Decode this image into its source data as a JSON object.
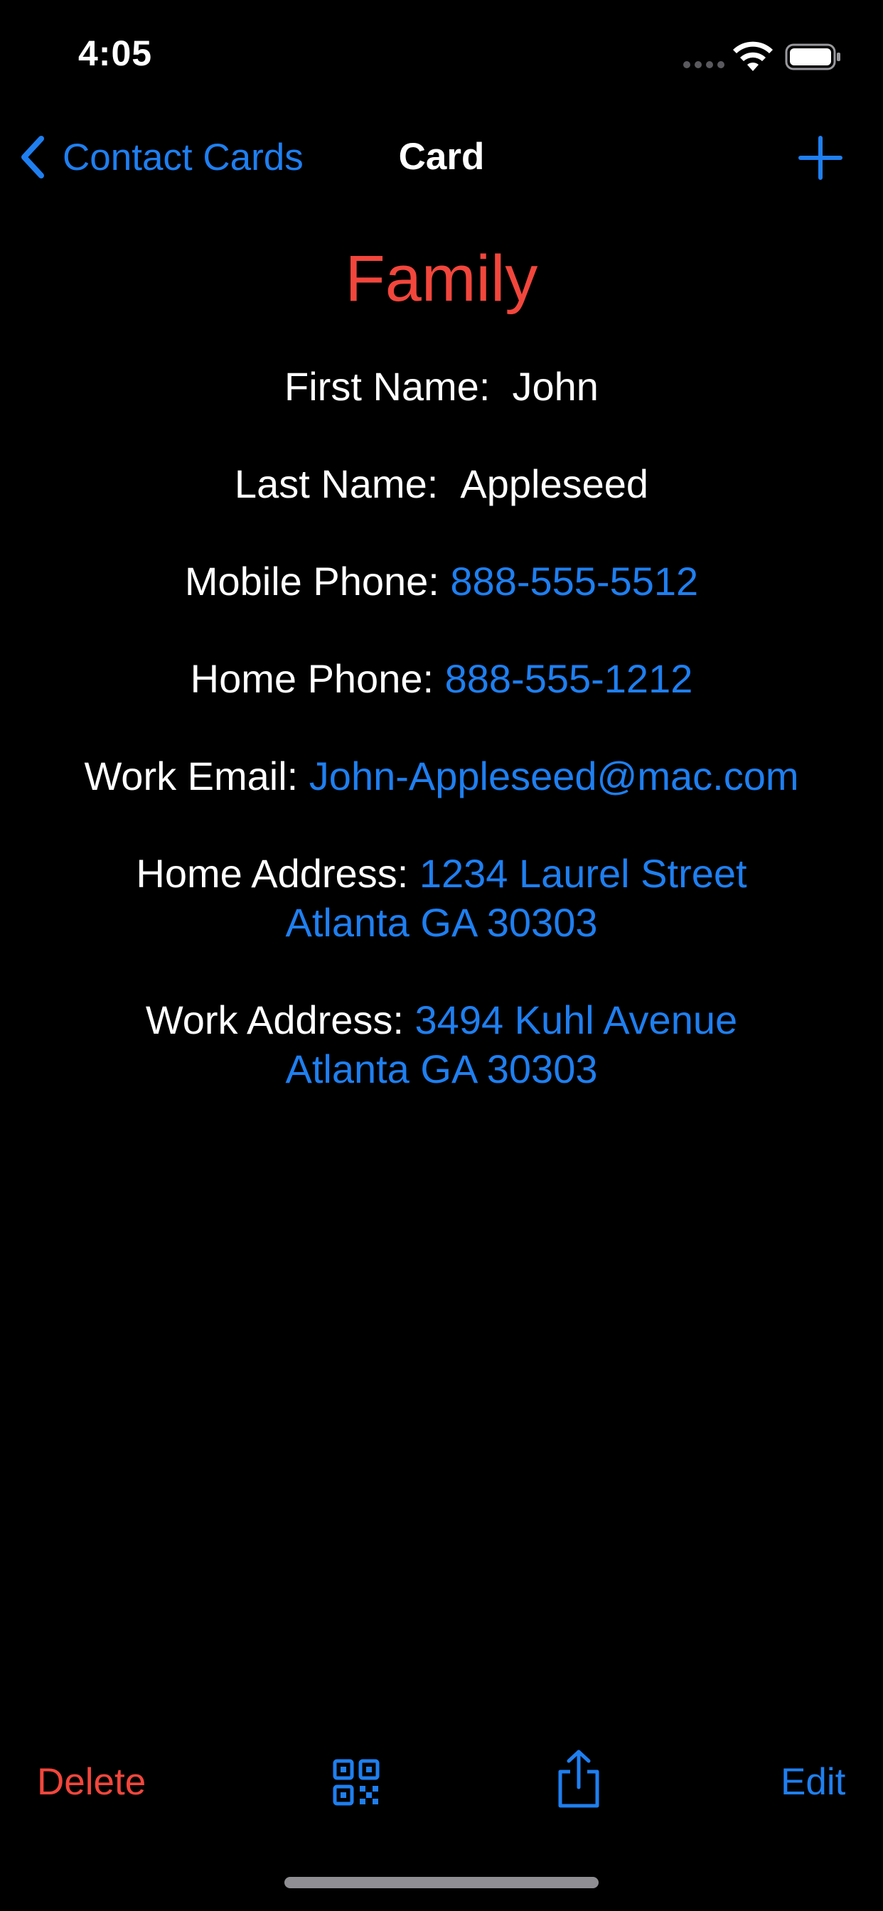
{
  "status_bar": {
    "time": "4:05"
  },
  "nav": {
    "back_label": "Contact Cards",
    "title": "Card"
  },
  "card": {
    "title": "Family",
    "fields": {
      "first_name": {
        "label": "First Name:",
        "value": "John"
      },
      "last_name": {
        "label": "Last Name:",
        "value": "Appleseed"
      },
      "mobile_phone": {
        "label": "Mobile Phone:",
        "value": "888-555-5512"
      },
      "home_phone": {
        "label": "Home Phone:",
        "value": "888-555-1212"
      },
      "work_email": {
        "label": "Work Email:",
        "value": "John-Appleseed@mac.com"
      },
      "home_address": {
        "label": "Home Address:",
        "line1": "1234 Laurel Street",
        "line2": "Atlanta GA 30303"
      },
      "work_address": {
        "label": "Work Address:",
        "line1": "3494 Kuhl Avenue",
        "line2": "Atlanta GA 30303"
      }
    }
  },
  "toolbar": {
    "delete_label": "Delete",
    "edit_label": "Edit"
  },
  "icons": {
    "back": "chevron-left-icon",
    "add": "plus-icon",
    "qr": "qr-code-icon",
    "share": "share-icon",
    "wifi": "wifi-icon",
    "battery": "battery-icon",
    "cellular": "cellular-signal-icon"
  },
  "colors": {
    "background": "#000000",
    "accent": "#1f7ff0",
    "destructive": "#f2463c",
    "text": "#ffffff"
  }
}
